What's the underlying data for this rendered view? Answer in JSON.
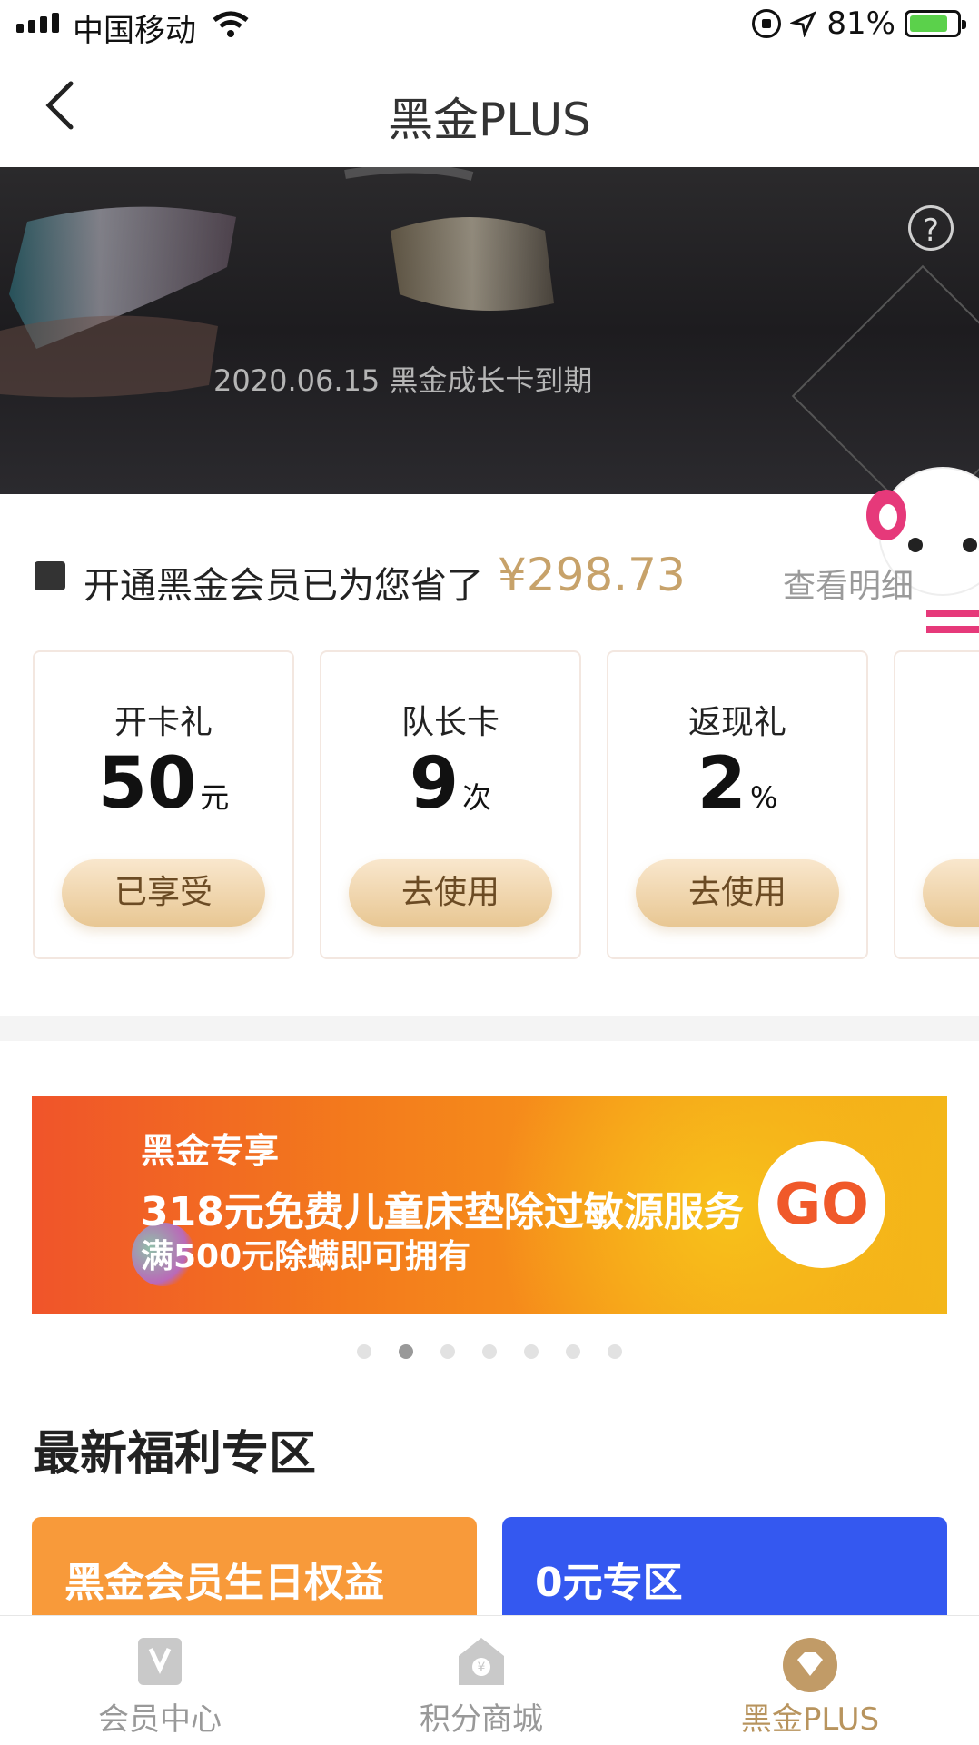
{
  "status_bar": {
    "carrier": "中国移动",
    "battery": "81%",
    "battery_level": 0.81
  },
  "nav": {
    "title": "黑金PLUS"
  },
  "hero": {
    "expiry_text": "2020.06.15 黑金成长卡到期",
    "help_symbol": "?"
  },
  "savings": {
    "text": "开通黑金会员已为您省了",
    "amount": "¥298.73",
    "details_link": "查看明细"
  },
  "benefits": [
    {
      "title": "开卡礼",
      "value": "50",
      "unit": "元",
      "button": "已享受"
    },
    {
      "title": "队长卡",
      "value": "9",
      "unit": "次",
      "button": "去使用"
    },
    {
      "title": "返现礼",
      "value": "2",
      "unit": "%",
      "button": "去使用"
    }
  ],
  "promo": {
    "tag": "黑金专享",
    "title": "318元免费儿童床垫除过敏源服务",
    "subtitle": "满500元除螨即可拥有",
    "go": "GO",
    "page_count": 7,
    "active_index": 1
  },
  "welfare": {
    "section_title": "最新福利专区",
    "cards": [
      {
        "label": "黑金会员生日权益",
        "color": "#f89a3a"
      },
      {
        "label": "0元专区",
        "color": "#3458f0"
      }
    ]
  },
  "tabbar": {
    "items": [
      {
        "label": "会员中心",
        "icon": "member-center-icon"
      },
      {
        "label": "积分商城",
        "icon": "points-mall-icon"
      },
      {
        "label": "黑金PLUS",
        "icon": "black-gold-plus-icon",
        "active": true
      }
    ]
  },
  "colors": {
    "gold": "#c7a26a",
    "promo_orange": "#f37a1c"
  }
}
